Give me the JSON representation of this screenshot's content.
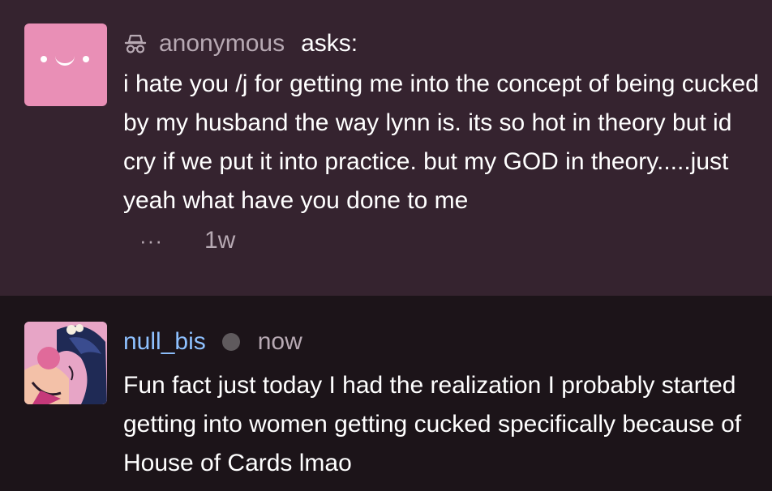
{
  "ask": {
    "author": "anonymous",
    "action": "asks:",
    "text": "i hate you /j for getting me into the concept of being cucked by my husband the way lynn is. its so hot in theory but id cry if we put it into practice. but my GOD in theory.....just yeah what have you done to me",
    "more": "···",
    "time": "1w",
    "avatar_color": "#e98fb6",
    "icon": "incognito-icon"
  },
  "reply": {
    "author": "null_bis",
    "time": "now",
    "text": "Fun fact just today I had the realization I probably started getting into women getting cucked specifically because of House of Cards lmao",
    "name_color": "#8ec1ff",
    "status": "offline"
  },
  "colors": {
    "ask_bg": "#35232f",
    "reply_bg": "#1c1419",
    "muted_text": "#b7a9b3"
  }
}
